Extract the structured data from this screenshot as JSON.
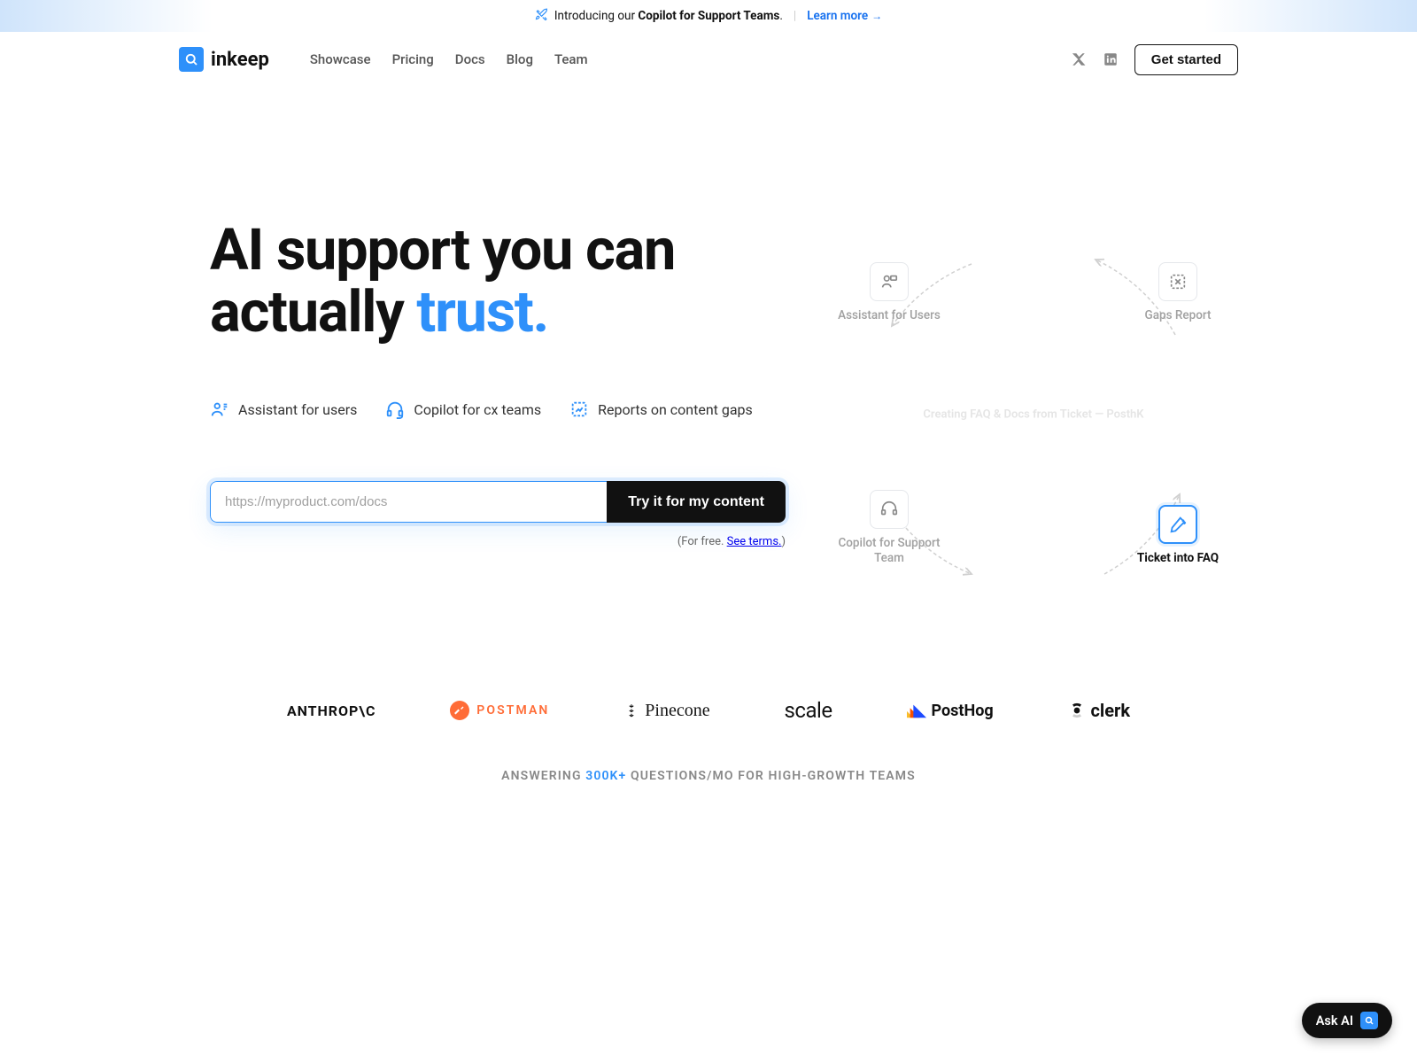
{
  "announce": {
    "prefix": "Introducing our ",
    "bold": "Copilot for Support Teams",
    "suffix": ".",
    "cta": "Learn more"
  },
  "brand": "inkeep",
  "nav": {
    "items": [
      "Showcase",
      "Pricing",
      "Docs",
      "Blog",
      "Team"
    ]
  },
  "header": {
    "get_started": "Get started"
  },
  "hero": {
    "line1": "AI support you can",
    "line2_a": "actually ",
    "line2_accent": "trust."
  },
  "features": {
    "a": "Assistant for users",
    "b": "Copilot for cx teams",
    "c": "Reports on content gaps"
  },
  "cta": {
    "placeholder": "https://myproduct.com/docs",
    "button": "Try it for my content",
    "note_a": "(For free. ",
    "note_terms": "See terms.",
    "note_b": ")"
  },
  "cycle": {
    "center": "Creating FAQ & Docs from Ticket — PosthK",
    "tl": "Assistant for Users",
    "tr": "Gaps Report",
    "br": "Ticket into FAQ",
    "bl": "Copilot for Support Team"
  },
  "logos": {
    "anthropic": "ANTHROP\\C",
    "postman": "POSTMAN",
    "pinecone": "Pinecone",
    "scale": "scale",
    "posthog": "PostHog",
    "clerk": "clerk"
  },
  "tagline": {
    "a": "Answering ",
    "highlight": "300K+",
    "b": " questions/mo for high-growth teams"
  },
  "ask_ai": "Ask AI"
}
